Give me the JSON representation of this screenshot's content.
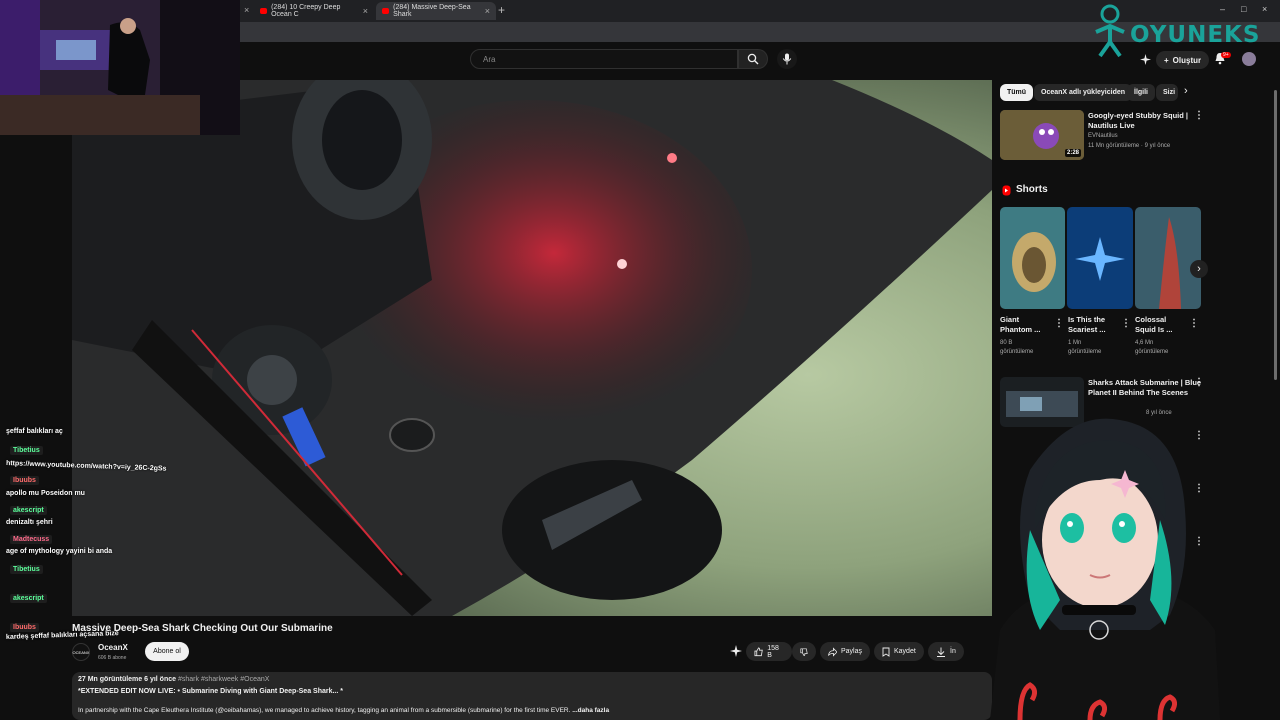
{
  "browser": {
    "tabs": [
      {
        "label": "(284) 10 Creepy Deep Ocean C"
      },
      {
        "label": "(284) Massive Deep-Sea Shark"
      }
    ],
    "new_tab_symbol": "+",
    "window_controls": [
      "–",
      "□",
      "×"
    ]
  },
  "header": {
    "search_placeholder": "Ara",
    "create_label": "Oluştur",
    "notification_count": "9+",
    "icons": [
      "search-icon",
      "mic-icon",
      "sparkle-icon",
      "bell-icon"
    ]
  },
  "overlay": {
    "logo_text": "OYUNEKS"
  },
  "chat": [
    {
      "user": "",
      "text": "şeffaf balıkları aç"
    },
    {
      "user": "Tibetius",
      "text": "https://www.youtube.com/watch?v=iy_26C-2gSs"
    },
    {
      "user": "Ibuubs",
      "text": "apollo mu Poseidon mu"
    },
    {
      "user": "akescript",
      "text": "denizaltı şehri"
    },
    {
      "user": "Madtecuss",
      "text": "age of mythology yayini bi anda"
    },
    {
      "user": "Tibetius",
      "text": ""
    },
    {
      "user": "akescript",
      "text": ""
    },
    {
      "user": "Ibuubs",
      "text": "kardeş şeffaf balıkları açsana bize"
    }
  ],
  "video": {
    "title": "Massive Deep-Sea Shark Checking Out Our Submarine",
    "channel": "OceanX",
    "channel_logo": "OCEANX",
    "subscribers": "606 B abone",
    "subscribe_label": "Abone ol",
    "likes": "158 B",
    "share_label": "Paylaş",
    "save_label": "Kaydet",
    "download_label": "İn",
    "views_date": "27 Mn görüntüleme  6 yıl önce",
    "tags": "#shark #sharkweek #OceanX",
    "desc_line1": "*EXTENDED EDIT NOW LIVE:  • Submarine Diving with Giant Deep-Sea Shark...  *",
    "desc_line2": "In partnership with the Cape Eleuthera Institute (@ceibahamas), we managed to achieve history, tagging an animal from a submersible (submarine) for the first time EVER.",
    "more_label": "...daha fazla"
  },
  "sidebar": {
    "chips": [
      "Tümü",
      "OceanX adlı yükleyiciden",
      "İlgili",
      "Sizi"
    ],
    "top_video": {
      "title_l1": "Googly-eyed Stubby Squid |",
      "title_l2": "Nautilus Live",
      "channel": "EVNautilus",
      "meta": "11 Mn görüntüleme · 9 yıl önce",
      "duration": "2:28"
    },
    "shorts_label": "Shorts",
    "shorts": [
      {
        "title_l1": "Giant",
        "title_l2": "Phantom ...",
        "views_l1": "80 B",
        "views_l2": "görüntüleme"
      },
      {
        "title_l1": "Is This the",
        "title_l2": "Scariest ...",
        "views_l1": "1 Mn",
        "views_l2": "görüntüleme"
      },
      {
        "title_l1": "Colossal",
        "title_l2": "Squid Is ...",
        "views_l1": "4,6 Mn",
        "views_l2": "görüntüleme"
      }
    ],
    "video2": {
      "title_l1": "Sharks Attack Submarine | Blue",
      "title_l2": "Planet II Behind The Scenes",
      "meta": "8 yıl önce"
    }
  }
}
